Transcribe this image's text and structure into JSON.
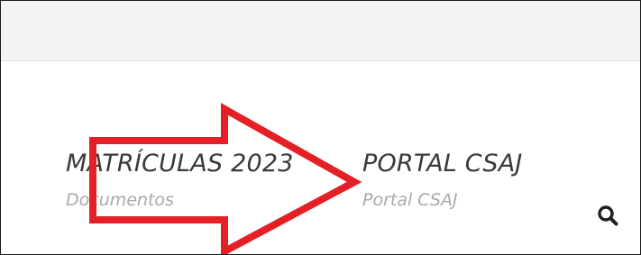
{
  "nav": {
    "items": [
      {
        "title": "MATRÍCULAS 2023",
        "subtitle": "Documentos"
      },
      {
        "title": "PORTAL CSAJ",
        "subtitle": "Portal CSAJ"
      }
    ]
  },
  "search": {
    "icon": "search-icon"
  },
  "annotation": {
    "shape": "arrow",
    "color": "#e41f26"
  }
}
